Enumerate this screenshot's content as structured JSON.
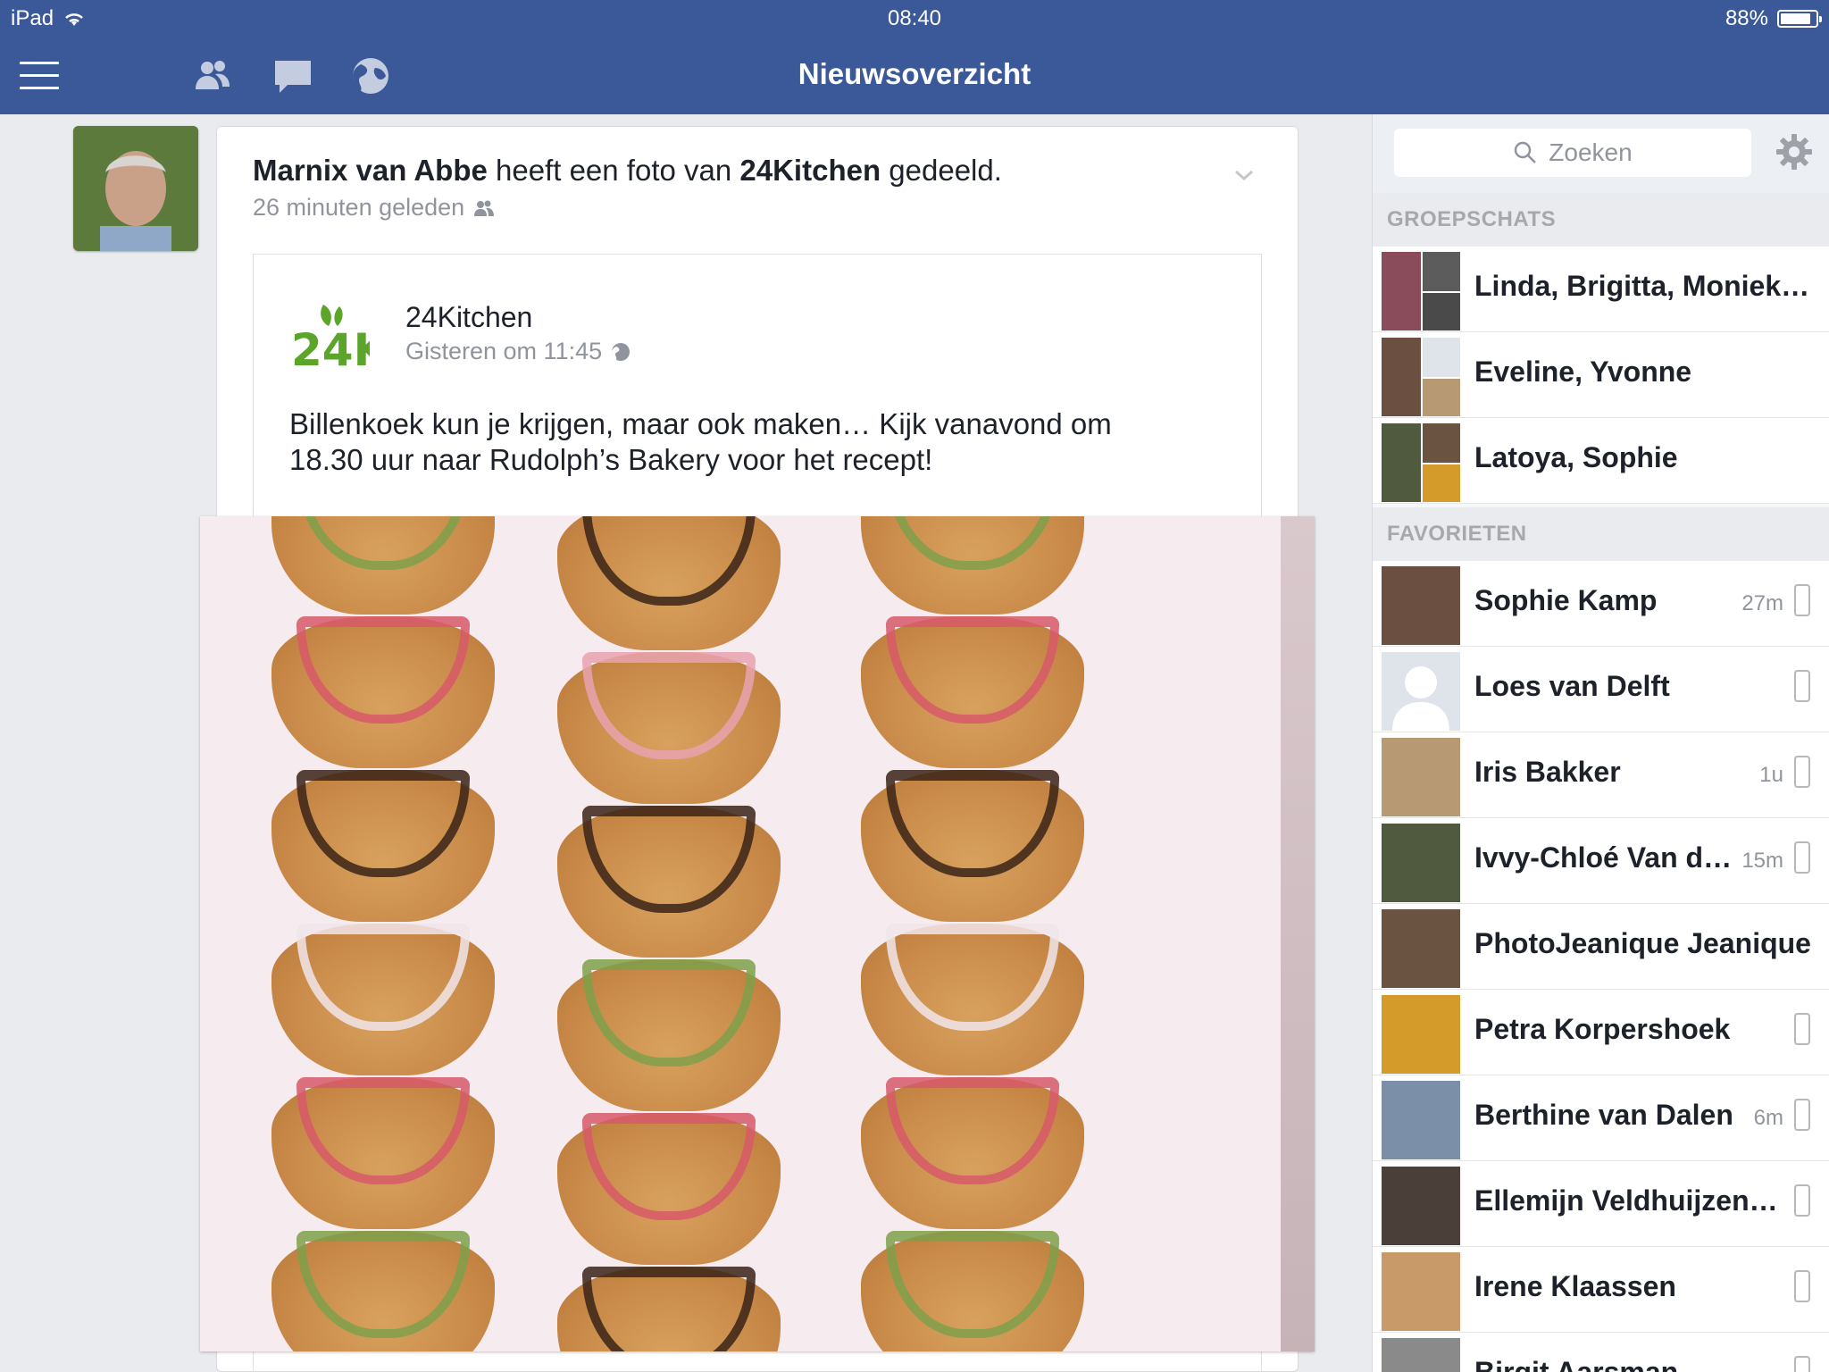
{
  "status_bar": {
    "device": "iPad",
    "time": "08:40",
    "battery": "88%",
    "battery_level": 0.88
  },
  "nav": {
    "title": "Nieuwsoverzicht",
    "icons": [
      "menu-icon",
      "friends-icon",
      "messages-icon",
      "globe-icon"
    ]
  },
  "post": {
    "actor": "Marnix van Abbe",
    "verb": " heeft een foto van ",
    "target": "24Kitchen",
    "suffix": " gedeeld.",
    "time": "26 minuten geleden",
    "shared": {
      "page_name": "24Kitchen",
      "page_time": "Gisteren om 11:45",
      "message_line1": "Billenkoek kun je krijgen, maar ook maken… Kijk vanavond om",
      "message_line2": "18.30 uur naar Rudolph’s Bakery voor het recept!"
    }
  },
  "sidebar": {
    "search_placeholder": "Zoeken",
    "group_header": "GROEPSCHATS",
    "groups": [
      {
        "name": "Linda, Brigitta, Moniek…"
      },
      {
        "name": "Eveline, Yvonne"
      },
      {
        "name": "Latoya, Sophie"
      }
    ],
    "favorites_header": "FAVORIETEN",
    "favorites": [
      {
        "name": "Sophie Kamp",
        "meta": "27m",
        "mobile": true
      },
      {
        "name": "Loes van Delft",
        "meta": "",
        "mobile": true
      },
      {
        "name": "Iris Bakker",
        "meta": "1u",
        "mobile": true
      },
      {
        "name": "Ivvy-Chloé Van d…",
        "meta": "15m",
        "mobile": true
      },
      {
        "name": "PhotoJeanique Jeanique",
        "meta": "",
        "mobile": false
      },
      {
        "name": "Petra Korpershoek",
        "meta": "",
        "mobile": true
      },
      {
        "name": "Berthine van Dalen",
        "meta": "6m",
        "mobile": true
      },
      {
        "name": "Ellemijn Veldhuijzen…",
        "meta": "",
        "mobile": true
      },
      {
        "name": "Irene Klaassen",
        "meta": "",
        "mobile": true
      },
      {
        "name": "Birgit Aarsman",
        "meta": "",
        "mobile": true
      }
    ]
  },
  "colors": {
    "brand": "#3b5998",
    "background": "#e9ebee",
    "logo_green": "#5aa52a"
  }
}
